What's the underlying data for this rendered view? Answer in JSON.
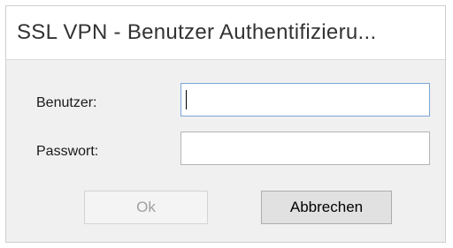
{
  "window": {
    "title": "SSL VPN - Benutzer Authentifizieru..."
  },
  "form": {
    "user_label": "Benutzer:",
    "user_value": "",
    "password_label": "Passwort:",
    "password_value": ""
  },
  "buttons": {
    "ok_label": "Ok",
    "ok_enabled": false,
    "cancel_label": "Abbrechen"
  },
  "colors": {
    "focus_border": "#7aa6d6",
    "dialog_background": "#f0f0f0"
  }
}
